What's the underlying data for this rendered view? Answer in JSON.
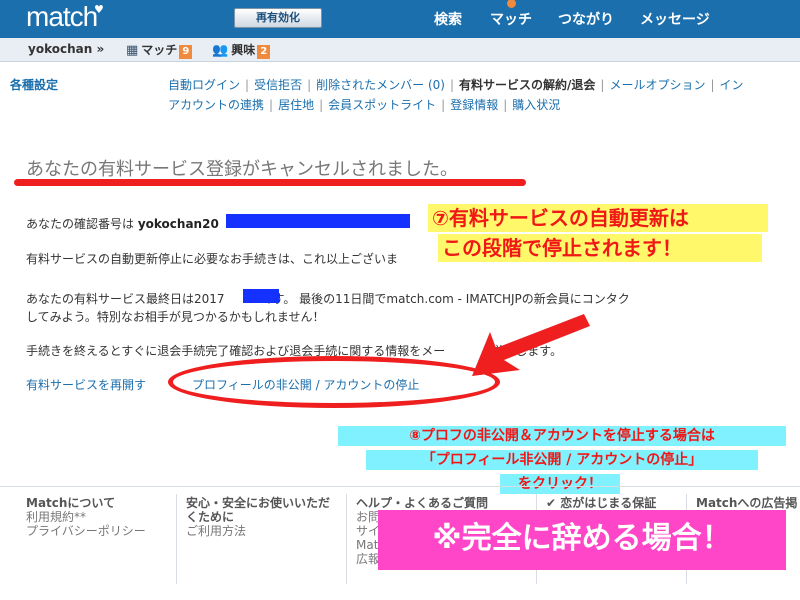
{
  "header": {
    "logo": "match",
    "reactivate_label": "再有効化",
    "nav": [
      "検索",
      "マッチ",
      "つながり",
      "メッセージ"
    ]
  },
  "subbar": {
    "username": "yokochan »",
    "match_label": "マッチ",
    "match_count": "9",
    "interest_label": "興味",
    "interest_count": "2"
  },
  "settings": {
    "title": "各種設定",
    "row1": [
      "自動ログイン",
      "受信拒否",
      "削除されたメンバー (0)",
      "有料サービスの解約/退会",
      "メールオプション",
      "イン"
    ],
    "row2": [
      "アカウントの連携",
      "居住地",
      "会員スポットライト",
      "登録情報",
      "購入状況"
    ]
  },
  "main": {
    "headline": "あなたの有料サービス登録がキャンセルされました。",
    "confirm_prefix": "あなたの確認番号は ",
    "confirm_value": "yokochan20",
    "autorenew_text": "有料サービスの自動更新停止に必要なお手続きは、これ以上ございま",
    "lastday_prefix": "あなたの有料サービス最終日は2017",
    "lastday_suffix": "です。 最後の11日間でmatch.com - IMATCHJPの新会員にコンタク",
    "lastday_line2": "してみよう。特別なお相手が見つかるかもしれません！",
    "procedure_text": "手続きを終えるとすぐに退会手続完了確認および退会手続に関する情報をメー",
    "procedure_tail": "送りします。",
    "resume_link": "有料サービスを再開す",
    "hide_profile_link": "プロフィールの非公開 / アカウントの停止"
  },
  "annotations": {
    "note7_line1": "⑦有料サービスの自動更新は",
    "note7_line2": "この段階で停止されます！",
    "note8_line1": "⑧プロフの非公開＆アカウントを停止する場合は",
    "note8_line2": "「プロフィール非公開 / アカウントの停止」",
    "note8_line3": "をクリック！",
    "pink_note": "※完全に辞める場合！"
  },
  "footer": {
    "col1": {
      "head": "Matchについて",
      "items": [
        "利用規約**",
        "プライバシーポリシー"
      ]
    },
    "col2": {
      "head": "安心・安全にお使いいただくために",
      "items": [
        "ご利用方法"
      ]
    },
    "col3": {
      "head": "ヘルプ・よくあるご質問",
      "items": [
        "お問",
        "サイ",
        "Mat",
        "広報資料"
      ]
    },
    "col4": {
      "head": "恋がはじまる保証"
    },
    "col5": {
      "head": "Matchへの広告掲",
      "items": [
        "/"
      ]
    }
  },
  "colors": {
    "brand_blue": "#1b6fad",
    "badge_orange": "#f08a3c",
    "annotation_red": "#ef1f1f",
    "redact_blue": "#1431ff",
    "note_yellow": "#fff86b",
    "note_cyan": "#7ff1ff",
    "note_pink": "#ff46c8"
  }
}
